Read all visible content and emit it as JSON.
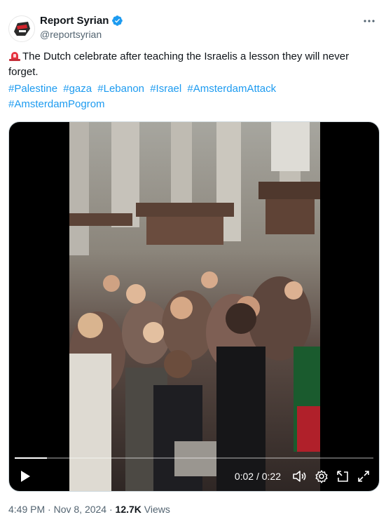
{
  "author": {
    "display_name": "Report Syrian",
    "handle": "@reportsyrian",
    "verified": true
  },
  "tweet": {
    "emoji": "siren-icon",
    "text": "The Dutch celebrate after teaching the Israelis a lesson they will never forget.",
    "hashtags": [
      "#Palestine",
      "#gaza",
      "#Lebanon",
      "#Israel",
      "#AmsterdamAttack",
      "#AmsterdamPogrom"
    ]
  },
  "video": {
    "time_display": "0:02 / 0:22",
    "progress": 0.09
  },
  "meta": {
    "time": "4:49 PM",
    "separator": "·",
    "date": "Nov 8, 2024",
    "views_count": "12.7K",
    "views_label": "Views"
  },
  "colors": {
    "link": "#1d9bf0",
    "verified": "#1d9bf0",
    "muted": "#536471"
  }
}
